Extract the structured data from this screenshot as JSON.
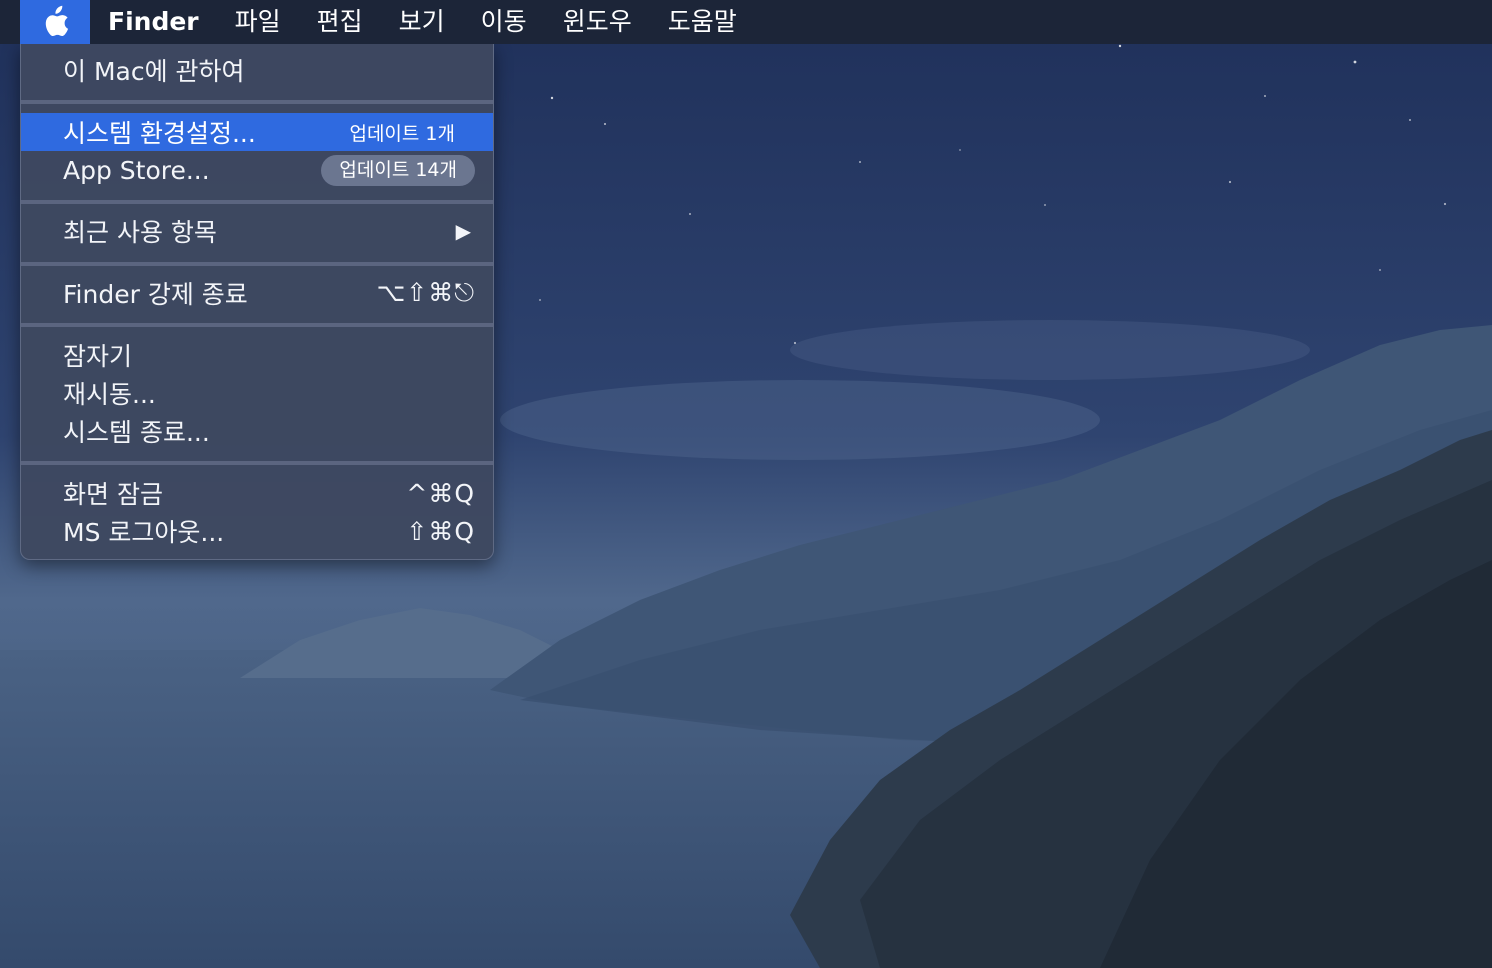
{
  "menubar": {
    "apple_icon": "apple-logo-icon",
    "items": [
      {
        "label": "Finder"
      },
      {
        "label": "파일"
      },
      {
        "label": "편집"
      },
      {
        "label": "보기"
      },
      {
        "label": "이동"
      },
      {
        "label": "윈도우"
      },
      {
        "label": "도움말"
      }
    ]
  },
  "apple_menu": {
    "about": "이 Mac에 관하여",
    "system_preferences": {
      "label": "시스템 환경설정...",
      "badge": "업데이트 1개"
    },
    "app_store": {
      "label": "App Store...",
      "badge": "업데이트 14개"
    },
    "recent_items": {
      "label": "최근 사용 항목",
      "arrow": "▶"
    },
    "force_quit": {
      "label": "Finder 강제 종료",
      "shortcut": "⌥⇧⌘⎋"
    },
    "sleep": "잠자기",
    "restart": "재시동...",
    "shutdown": "시스템 종료...",
    "lock_screen": {
      "label": "화면 잠금",
      "shortcut": "^⌘Q"
    },
    "logout": {
      "label": "MS 로그아웃...",
      "shortcut": "⇧⌘Q"
    }
  },
  "colors": {
    "accent": "#2f6ae0",
    "menubar_bg": "#1c2538",
    "menu_bg": "#3e4860"
  }
}
